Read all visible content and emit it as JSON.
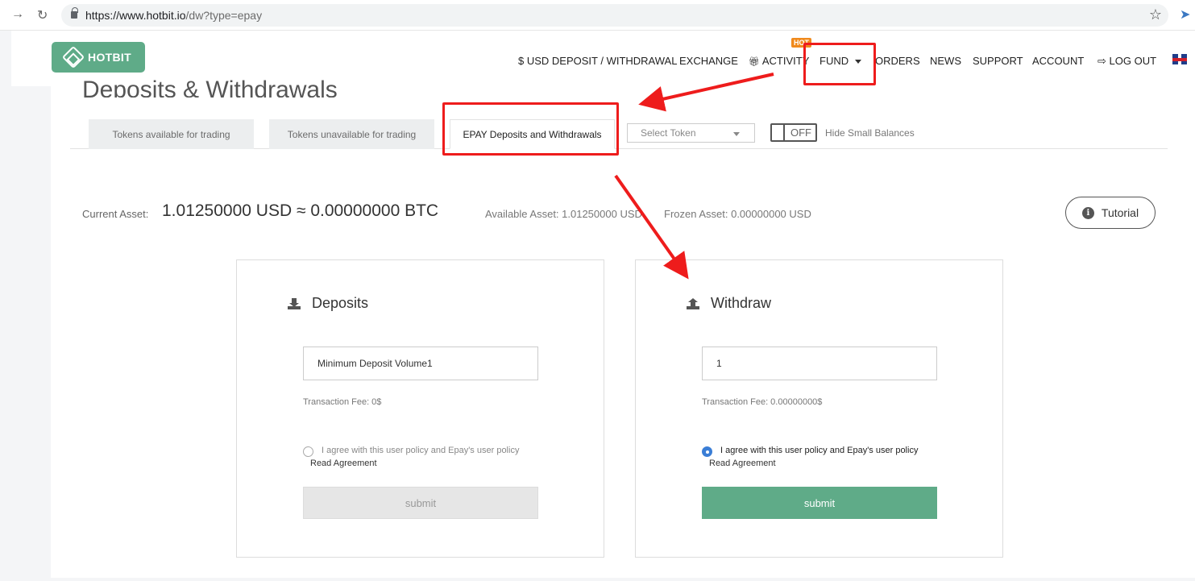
{
  "browser": {
    "url_host": "https://www.hotbit.io",
    "url_path": "/dw?type=epay",
    "back_icon": "back-arrow-icon",
    "reload_icon": "reload-icon",
    "star_glyph": "☆"
  },
  "header": {
    "logo_text": "HOTBIT",
    "hot_badge": "HOT",
    "menu": {
      "usd": "$ USD DEPOSIT / WITHDRAWAL",
      "exchange": "EXCHANGE",
      "activity": "ACTIVITY",
      "fund": "FUND",
      "orders": "ORDERS",
      "news": "NEWS",
      "support": "SUPPORT",
      "account": "ACCOUNT",
      "logout": "LOG OUT"
    }
  },
  "page": {
    "title": "Deposits & Withdrawals",
    "tabs": [
      "Tokens available for trading",
      "Tokens unavailable for trading",
      "EPAY Deposits and Withdrawals"
    ],
    "select_token": "Select Token",
    "toggle_state": "OFF",
    "hide_small": "Hide Small Balances"
  },
  "asset": {
    "label": "Current Asset:",
    "value": "1.01250000 USD ≈ 0.00000000 BTC",
    "available": "Available Asset: 1.01250000 USD",
    "frozen": "Frozen Asset: 0.00000000 USD",
    "tutorial": "Tutorial"
  },
  "deposit": {
    "title": "Deposits",
    "input_value": "Minimum Deposit Volume1",
    "fee": "Transaction Fee: 0$",
    "agree": "I agree with this user policy and Epay's user policy",
    "read": "Read Agreement",
    "submit": "submit",
    "checked": false
  },
  "withdraw": {
    "title": "Withdraw",
    "input_value": "1",
    "fee": "Transaction Fee: 0.00000000$",
    "agree": "I agree with this user policy and Epay's user policy",
    "read": "Read Agreement",
    "submit": "submit",
    "checked": true
  },
  "colors": {
    "brand": "#5fab88",
    "annotation": "#ee1c1c",
    "radio_checked": "#3b7ed6"
  }
}
